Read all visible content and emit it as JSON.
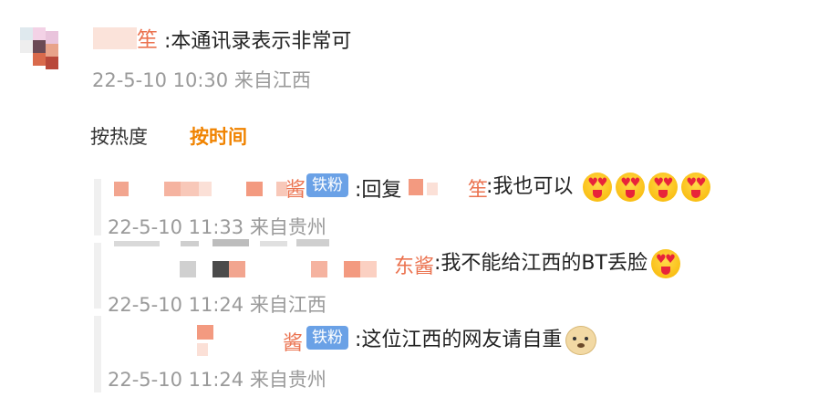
{
  "main_comment": {
    "name": "笙",
    "text": ":本通讯录表示非常可",
    "time": "22-5-10 10:30",
    "location": "来自江西"
  },
  "sort": {
    "hot_label": "按热度",
    "time_label": "按时间"
  },
  "replies": [
    {
      "name": "酱",
      "badge": "铁粉",
      "text": ":回复",
      "reply_to": "笙",
      "text2": ":我也可以",
      "emojis": [
        "heart-eyes-tongue-icon",
        "heart-eyes-tongue-icon",
        "heart-eyes-tongue-icon",
        "heart-eyes-tongue-icon"
      ],
      "time": "22-5-10 11:33",
      "location": "来自贵州"
    },
    {
      "name": "东酱",
      "text": ":我不能给江西的BT丢脸",
      "emojis": [
        "heart-eyes-tongue-icon"
      ],
      "time": "22-5-10 11:24",
      "location": "来自江西"
    },
    {
      "name": "酱",
      "badge": "铁粉",
      "text": ":这位江西的网友请自重",
      "emojis": [
        "doge-icon"
      ],
      "time": "22-5-10 11:24",
      "location": "来自贵州"
    }
  ],
  "colors": {
    "username": "#eb7350",
    "active_sort": "#f08300",
    "badge": "#6aa1e6",
    "meta": "#9a9a9a"
  }
}
